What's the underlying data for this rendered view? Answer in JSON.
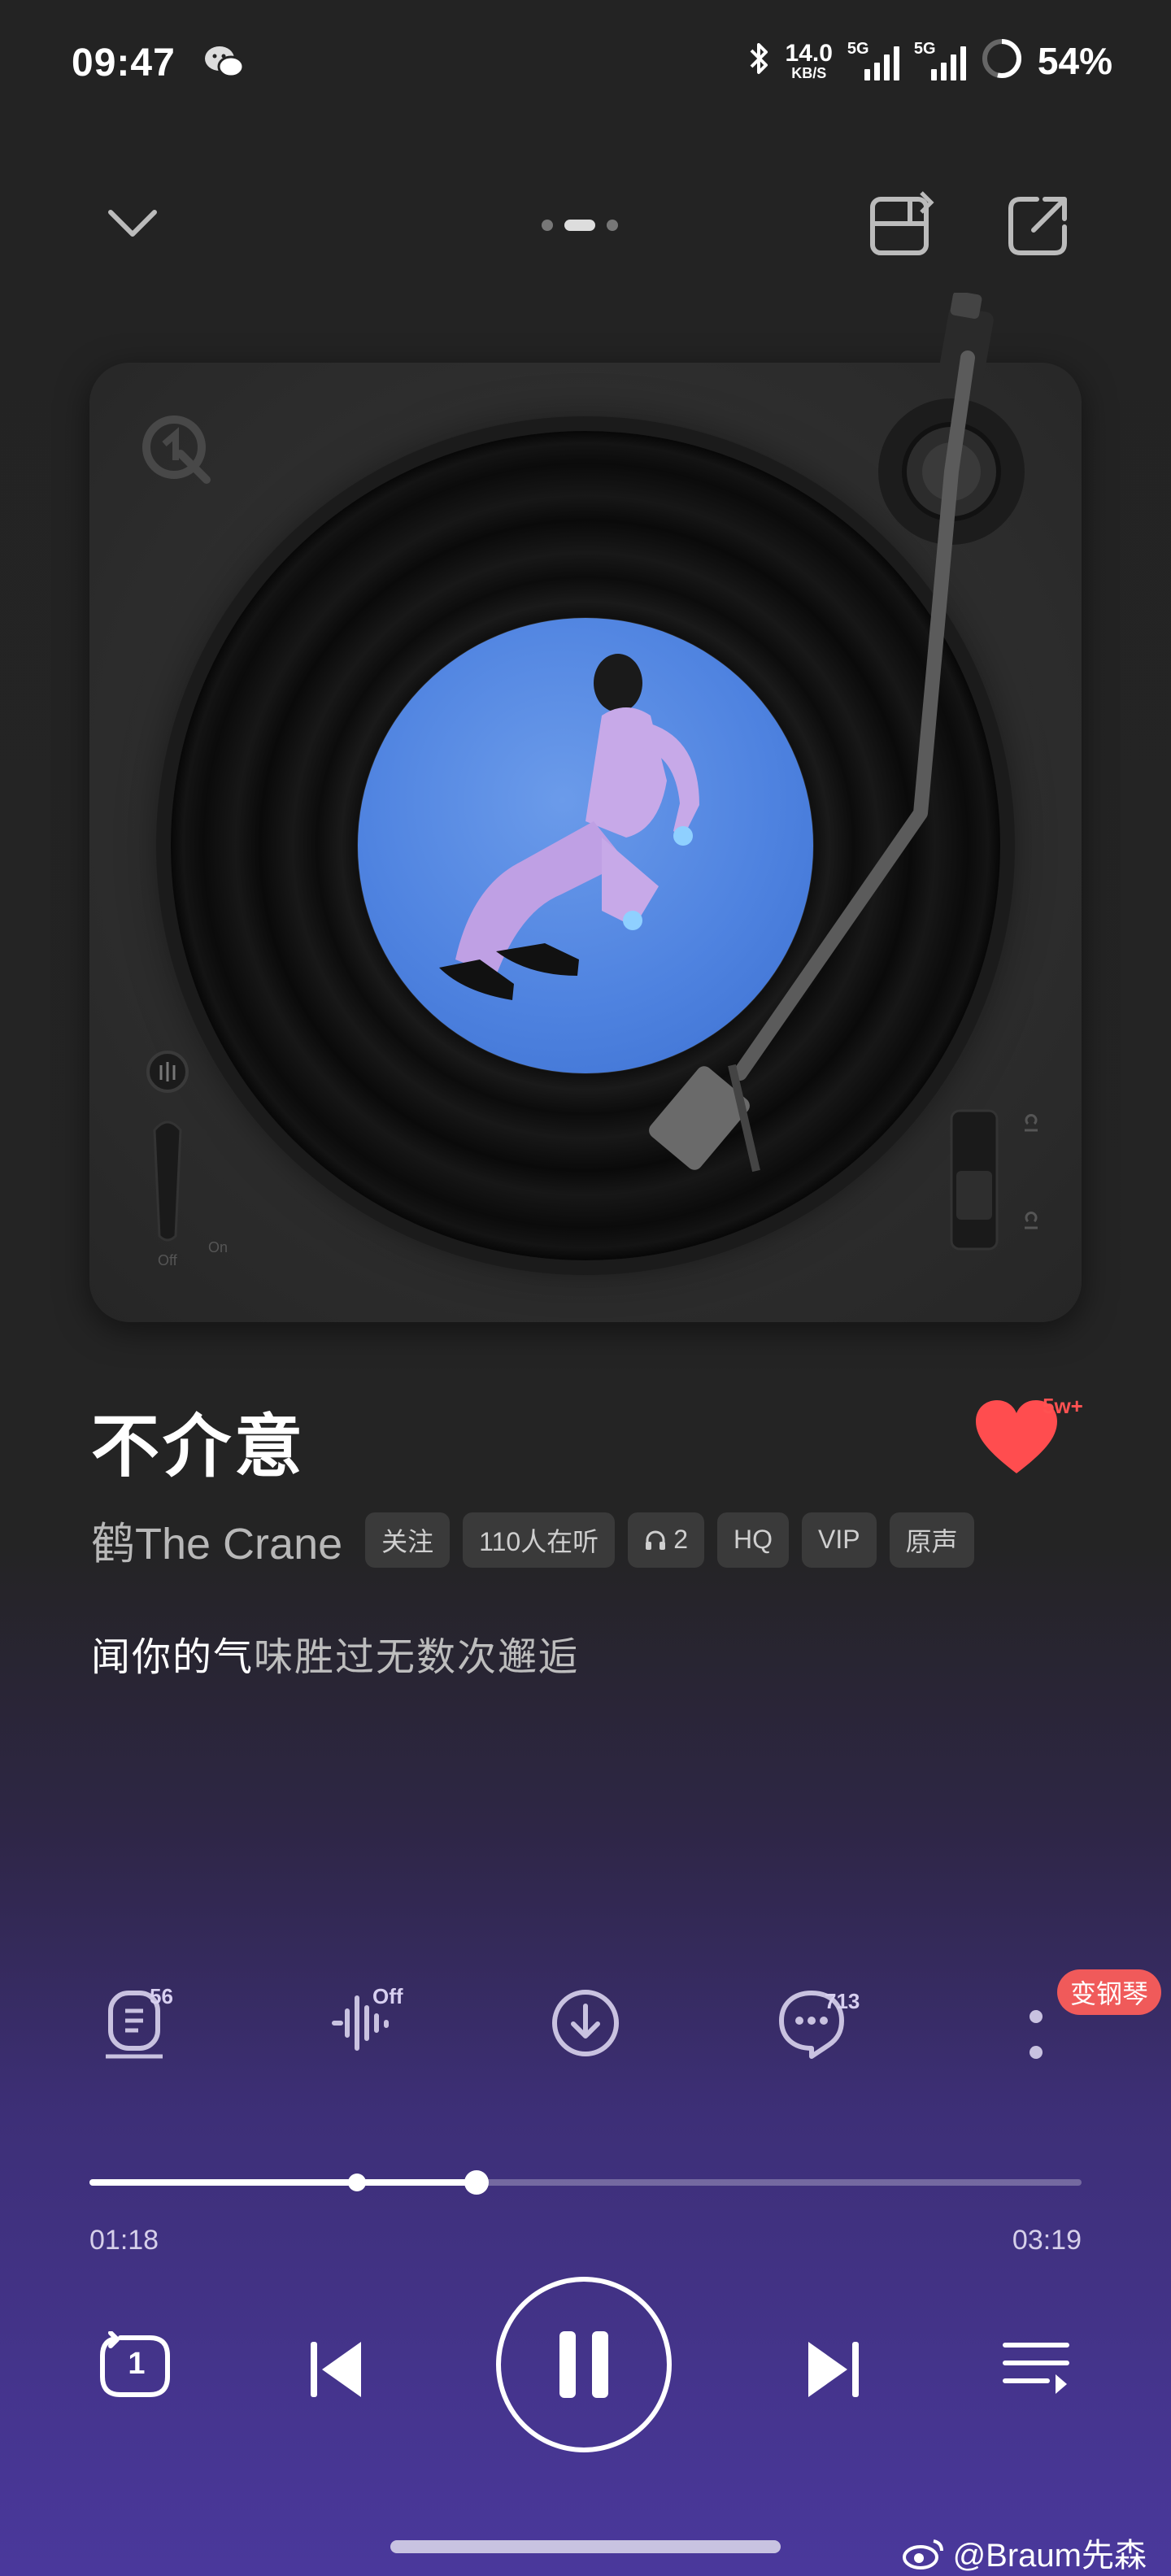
{
  "status_bar": {
    "time": "09:47",
    "net_speed_value": "14.0",
    "net_speed_unit": "KB/S",
    "sim1": "5G",
    "sim2": "5G",
    "battery": "54%"
  },
  "header": {
    "pages_total": 3,
    "current_page": 2
  },
  "song": {
    "title": "不介意",
    "artist": "鹤The Crane",
    "likes": "5w+",
    "chips": {
      "follow": "关注",
      "listeners": "110人在听",
      "headphones_count": "2",
      "quality": "HQ",
      "vip": "VIP",
      "original": "原声"
    },
    "lyric_sung": "闻你的气",
    "lyric_rest": "味胜过无数次邂逅"
  },
  "actions": {
    "lyrics_count": "56",
    "effect_state": "Off",
    "comments_count": "713",
    "piano_pill": "变钢琴"
  },
  "progress": {
    "elapsed": "01:18",
    "total": "03:19",
    "played_fraction": 0.39,
    "buffered_fraction": 0.27
  },
  "controls": {
    "repeat_count": "1"
  },
  "watermark": "@Braum先森",
  "colors": {
    "like_red": "#ff5252",
    "pill_red": "#f05a5a",
    "bottom_purple": "#4a389c"
  }
}
